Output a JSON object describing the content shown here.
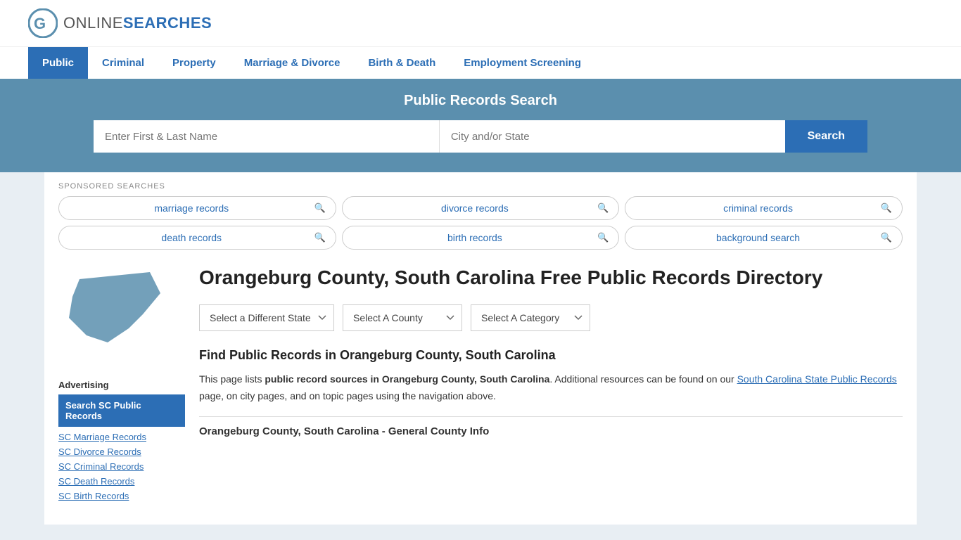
{
  "logo": {
    "online": "ONLINE",
    "searches": "SEARCHES"
  },
  "nav": {
    "items": [
      {
        "label": "Public",
        "active": true
      },
      {
        "label": "Criminal",
        "active": false
      },
      {
        "label": "Property",
        "active": false
      },
      {
        "label": "Marriage & Divorce",
        "active": false
      },
      {
        "label": "Birth & Death",
        "active": false
      },
      {
        "label": "Employment Screening",
        "active": false
      }
    ]
  },
  "search_banner": {
    "title": "Public Records Search",
    "name_placeholder": "Enter First & Last Name",
    "location_placeholder": "City and/or State",
    "search_button": "Search"
  },
  "sponsored": {
    "label": "SPONSORED SEARCHES",
    "items": [
      "marriage records",
      "divorce records",
      "criminal records",
      "death records",
      "birth records",
      "background search"
    ]
  },
  "sidebar": {
    "advertising_label": "Advertising",
    "highlight_text": "Search SC Public Records",
    "links": [
      "SC Marriage Records",
      "SC Divorce Records",
      "SC Criminal Records",
      "SC Death Records",
      "SC Birth Records"
    ]
  },
  "main": {
    "page_title": "Orangeburg County, South Carolina Free Public Records Directory",
    "dropdowns": {
      "state": "Select a Different State",
      "county": "Select A County",
      "category": "Select A Category"
    },
    "find_title": "Find Public Records in Orangeburg County, South Carolina",
    "description_part1": "This page lists ",
    "description_bold": "public record sources in Orangeburg County, South Carolina",
    "description_part2": ". Additional resources can be found on our ",
    "description_link": "South Carolina State Public Records",
    "description_part3": " page, on city pages, and on topic pages using the navigation above.",
    "county_info_title": "Orangeburg County, South Carolina - General County Info"
  }
}
